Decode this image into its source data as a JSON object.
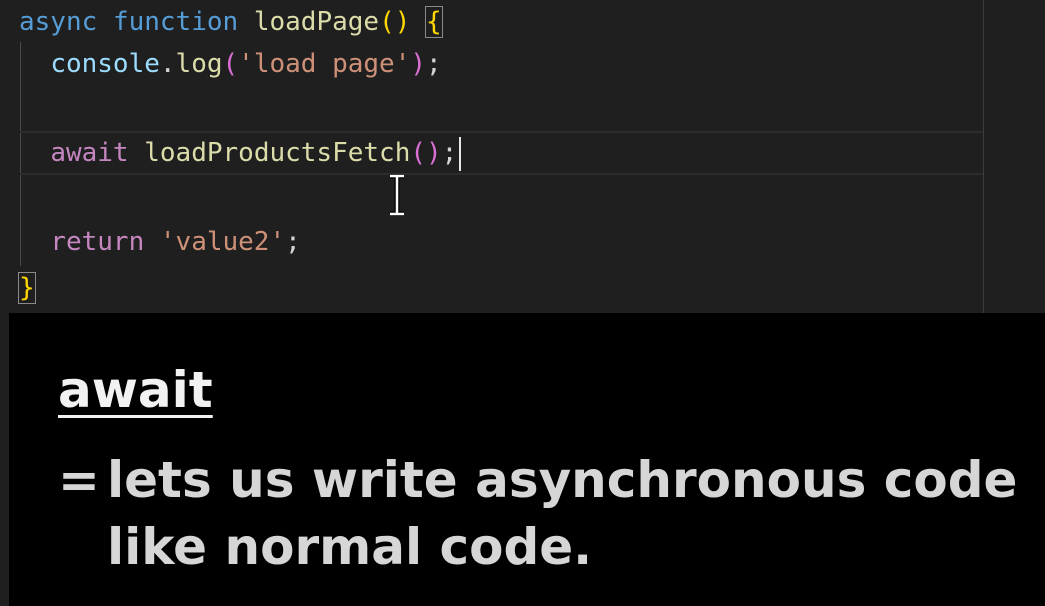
{
  "editor": {
    "line1": {
      "kw1": "async",
      "kw2": "function",
      "fn": "loadPage",
      "parens": "()",
      "brace": "{"
    },
    "line2": {
      "obj": "console",
      "dot": ".",
      "fn": "log",
      "open": "(",
      "str": "'load page'",
      "close": ")",
      "semi": ";"
    },
    "line3": {
      "kw": "await",
      "fn": "loadProductsFetch",
      "parens": "()",
      "semi": ";"
    },
    "line4": {
      "kw": "return",
      "str": "'value2'",
      "semi": ";"
    },
    "line5": {
      "brace": "}"
    }
  },
  "caption": {
    "title": "await",
    "equals": "=",
    "line1": "lets us write asynchronous code",
    "line2": "like normal code."
  },
  "colors": {
    "editor_bg": "#1f1f1f",
    "keyword": "#569cd6",
    "control_keyword": "#c586c0",
    "function": "#dcdcaa",
    "variable": "#9cdcfe",
    "string": "#ce9178",
    "brace": "#ffd700",
    "caption_bg": "#000000",
    "caption_text": "#d6d6d6"
  },
  "icons": {
    "cursor": "text-cursor-ibeam-icon"
  }
}
